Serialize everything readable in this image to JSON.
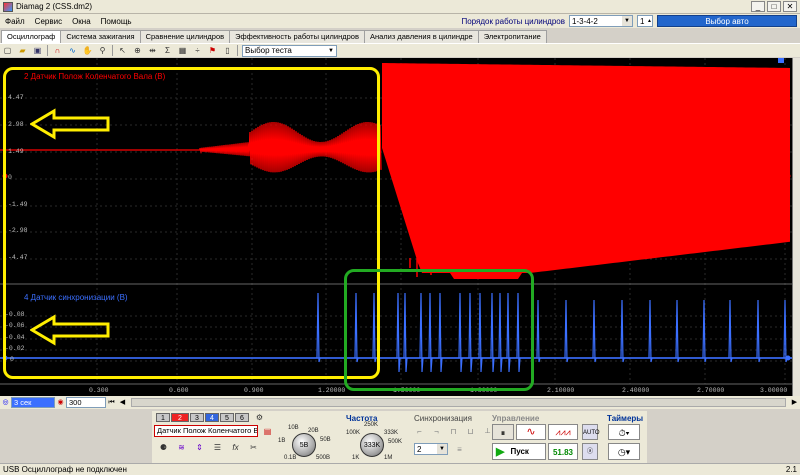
{
  "window": {
    "title": "Diamag 2 (CSS.dm2)",
    "min": "_",
    "max": "□",
    "close": "✕"
  },
  "menu": [
    "Файл",
    "Сервис",
    "Окна",
    "Помощь"
  ],
  "cyl_order": {
    "label": "Порядок работы цилиндров",
    "value": "1-3-4-2",
    "count": "1",
    "car_button": "Выбор авто"
  },
  "tabs": [
    "Осциллограф",
    "Система зажигания",
    "Сравнение цилиндров",
    "Эффективность работы цилиндров",
    "Анализ давления в цилиндре",
    "Электропитание"
  ],
  "toolbar": {
    "test_select": "Выбор теста"
  },
  "channel1": {
    "title": "2 Датчик Полож Коленчатого Вала (В)",
    "color": "#ff0000",
    "ticks": [
      "4.47",
      "2.98",
      "1.49",
      "0",
      "-1.49",
      "-2.98",
      "-4.47"
    ]
  },
  "channel2": {
    "title": "4 Датчик синхронизации (В)",
    "color": "#3b6fff",
    "ticks": [
      "-0.08",
      "-0.06",
      "-0.04",
      "-0.02",
      "0"
    ]
  },
  "time_axis": [
    "0.300",
    "0.600",
    "0.900",
    "1.20000",
    "1.50000",
    "1.80000",
    "2.10000",
    "2.40000",
    "2.70000",
    "3.00000"
  ],
  "bottom_nav": {
    "time_value": "3 сек",
    "samples": "300"
  },
  "control_panel": {
    "channel_buttons": [
      "1",
      "2",
      "3",
      "4",
      "5",
      "6"
    ],
    "channel_select": "Датчик Полож Коленчатого Ва",
    "range_labels": [
      "10B",
      "20B",
      "50B",
      "1B",
      "0.1B",
      "500B"
    ],
    "range_value": "5B",
    "frequency_title": "Частота",
    "frequency_labels": [
      "250K",
      "100K",
      "333K",
      "500K",
      "1K",
      "1M"
    ],
    "frequency_value": "333K",
    "sync_title": "Синхронизация",
    "sync_value": "2",
    "control_title": "Управление",
    "start_button": "Пуск",
    "fps_value": "51.83",
    "timers_title": "Таймеры"
  },
  "status": {
    "left": "USB Осциллограф не подключен",
    "right": "2.1"
  },
  "colors": {
    "highlight_yellow": "#ffee00",
    "highlight_green": "#22aa22",
    "signal_red": "#ff0000",
    "signal_blue": "#3b6fff",
    "selected_car": "#2266cc"
  }
}
